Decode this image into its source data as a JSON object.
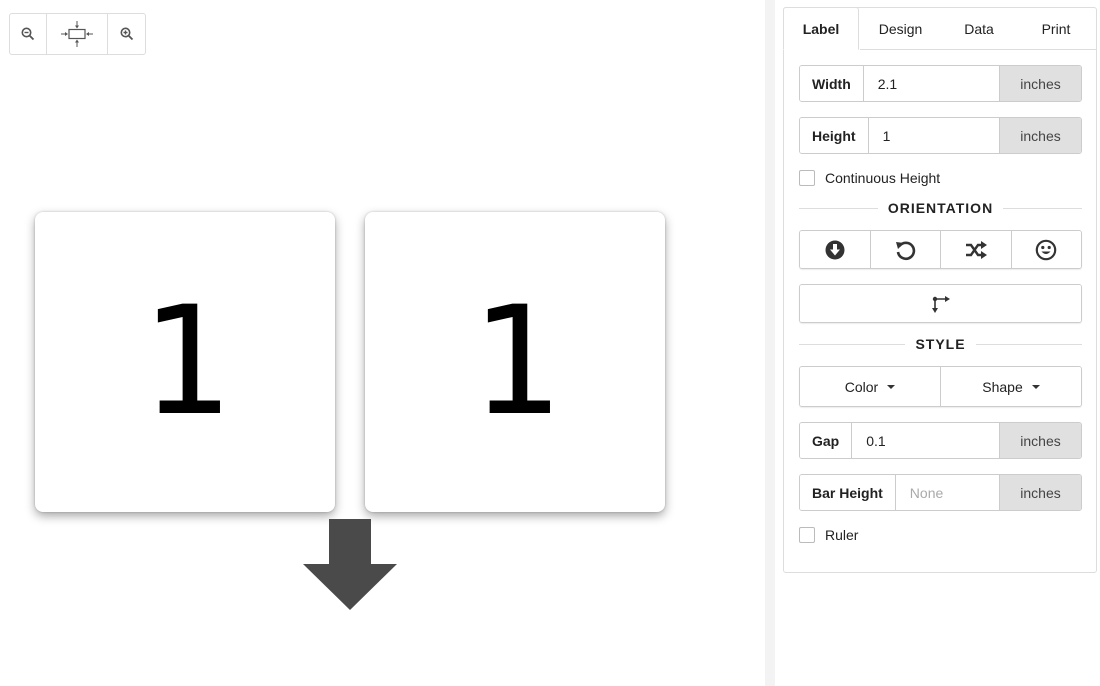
{
  "zoom_toolbar": {
    "zoom_out_icon": "zoom-out-icon",
    "fit_icon": "fit-to-page-icon",
    "zoom_in_icon": "zoom-in-icon"
  },
  "preview": {
    "labels": [
      "1",
      "1"
    ],
    "flow_direction_icon": "arrow-down-icon"
  },
  "tabs": [
    {
      "label": "Label",
      "active": true
    },
    {
      "label": "Design",
      "active": false
    },
    {
      "label": "Data",
      "active": false
    },
    {
      "label": "Print",
      "active": false
    }
  ],
  "label_settings": {
    "width": {
      "label": "Width",
      "value": "2.1",
      "unit": "inches"
    },
    "height": {
      "label": "Height",
      "value": "1",
      "unit": "inches"
    },
    "continuous_height": {
      "label": "Continuous Height",
      "checked": false
    },
    "orientation_heading": "ORIENTATION",
    "orientation_icons": [
      "arrow-circle-down-icon",
      "rotate-left-icon",
      "shuffle-icon",
      "smiley-icon"
    ],
    "direction_icon": "split-arrow-icon",
    "style_heading": "STYLE",
    "color_label": "Color",
    "shape_label": "Shape",
    "gap": {
      "label": "Gap",
      "value": "0.1",
      "unit": "inches"
    },
    "bar_height": {
      "label": "Bar Height",
      "placeholder": "None",
      "value": "",
      "unit": "inches"
    },
    "ruler": {
      "label": "Ruler",
      "checked": false
    }
  },
  "colors": {
    "arrow": "#4a4a4a",
    "unit_bg": "#e0e0e0",
    "border": "#cccccc"
  }
}
